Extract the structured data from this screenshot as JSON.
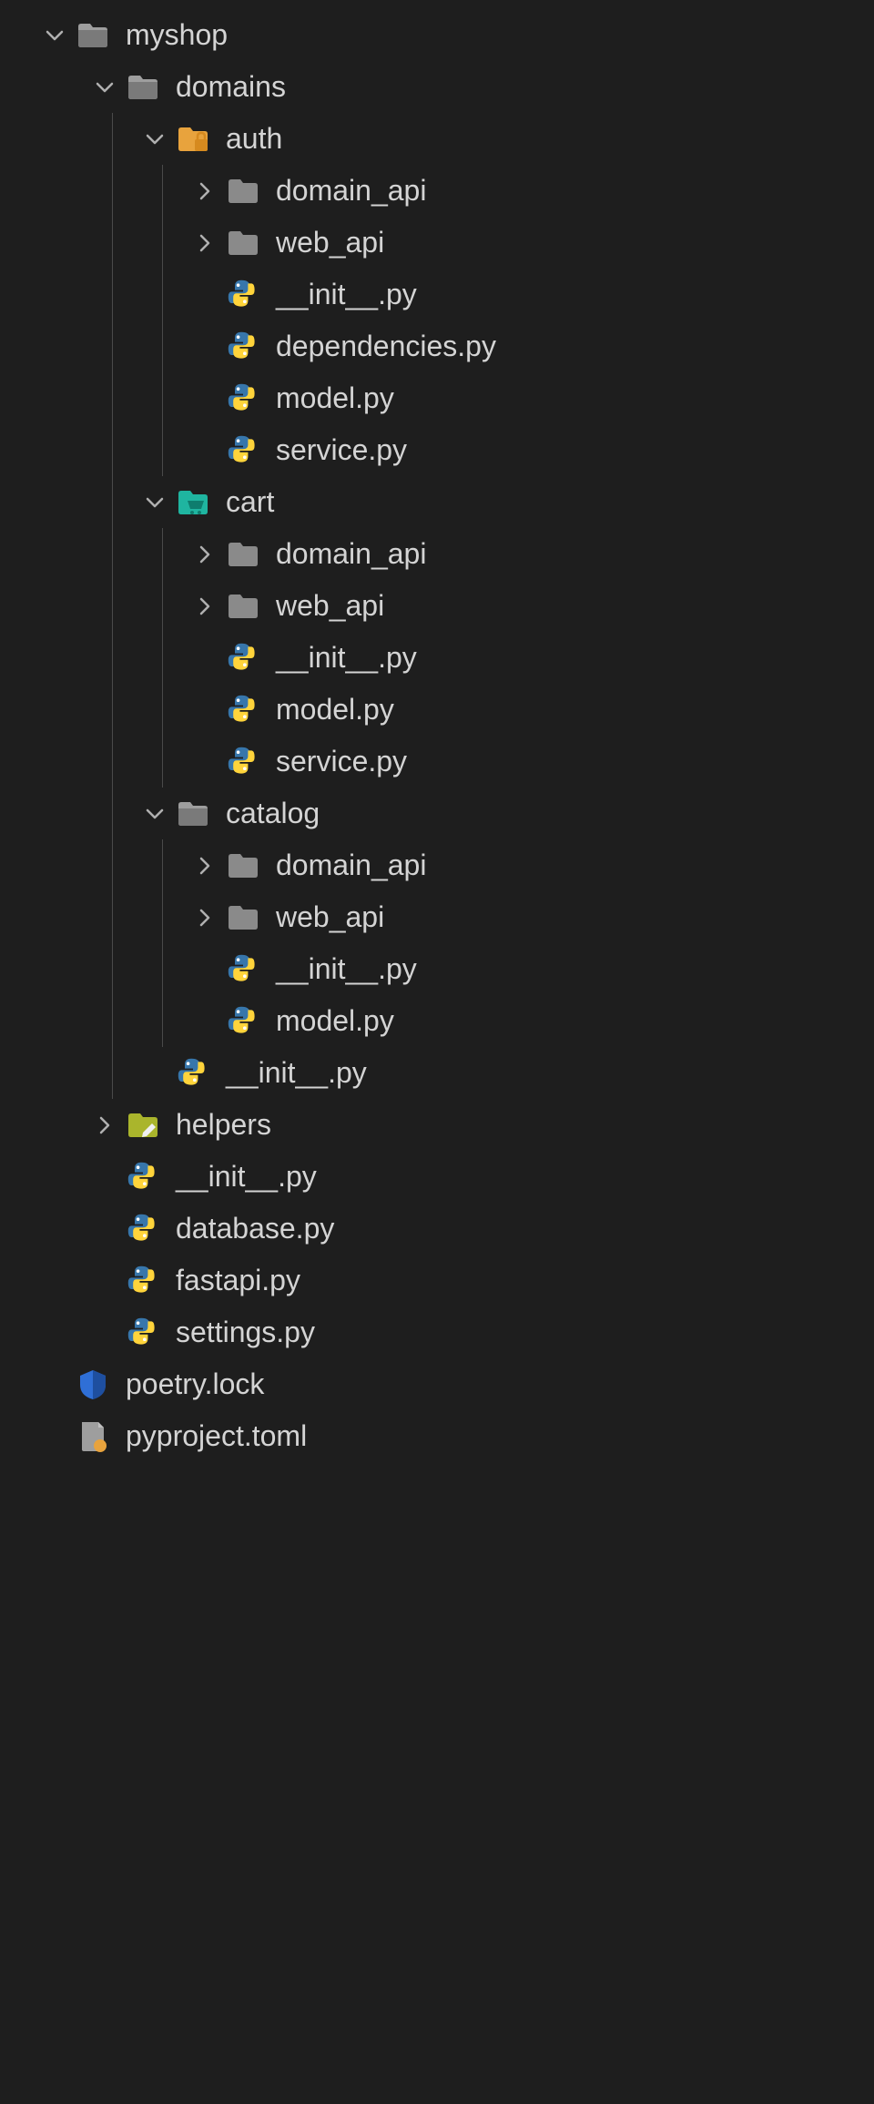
{
  "tree": [
    {
      "depth": 0,
      "chev": "down",
      "icon": "folder-open",
      "label": "myshop"
    },
    {
      "depth": 1,
      "chev": "down",
      "icon": "folder-open",
      "label": "domains"
    },
    {
      "depth": 2,
      "chev": "down",
      "icon": "folder-lock",
      "label": "auth"
    },
    {
      "depth": 3,
      "chev": "right",
      "icon": "folder",
      "label": "domain_api"
    },
    {
      "depth": 3,
      "chev": "right",
      "icon": "folder",
      "label": "web_api"
    },
    {
      "depth": 3,
      "chev": "none",
      "icon": "python",
      "label": "__init__.py"
    },
    {
      "depth": 3,
      "chev": "none",
      "icon": "python",
      "label": "dependencies.py"
    },
    {
      "depth": 3,
      "chev": "none",
      "icon": "python",
      "label": "model.py"
    },
    {
      "depth": 3,
      "chev": "none",
      "icon": "python",
      "label": "service.py"
    },
    {
      "depth": 2,
      "chev": "down",
      "icon": "folder-cart",
      "label": "cart"
    },
    {
      "depth": 3,
      "chev": "right",
      "icon": "folder",
      "label": "domain_api"
    },
    {
      "depth": 3,
      "chev": "right",
      "icon": "folder",
      "label": "web_api"
    },
    {
      "depth": 3,
      "chev": "none",
      "icon": "python",
      "label": "__init__.py"
    },
    {
      "depth": 3,
      "chev": "none",
      "icon": "python",
      "label": "model.py"
    },
    {
      "depth": 3,
      "chev": "none",
      "icon": "python",
      "label": "service.py"
    },
    {
      "depth": 2,
      "chev": "down",
      "icon": "folder-open",
      "label": "catalog"
    },
    {
      "depth": 3,
      "chev": "right",
      "icon": "folder",
      "label": "domain_api"
    },
    {
      "depth": 3,
      "chev": "right",
      "icon": "folder",
      "label": "web_api"
    },
    {
      "depth": 3,
      "chev": "none",
      "icon": "python",
      "label": "__init__.py"
    },
    {
      "depth": 3,
      "chev": "none",
      "icon": "python",
      "label": "model.py"
    },
    {
      "depth": 2,
      "chev": "none",
      "icon": "python",
      "label": "__init__.py"
    },
    {
      "depth": 1,
      "chev": "right",
      "icon": "folder-edit",
      "label": "helpers"
    },
    {
      "depth": 1,
      "chev": "none",
      "icon": "python",
      "label": "__init__.py"
    },
    {
      "depth": 1,
      "chev": "none",
      "icon": "python",
      "label": "database.py"
    },
    {
      "depth": 1,
      "chev": "none",
      "icon": "python",
      "label": "fastapi.py"
    },
    {
      "depth": 1,
      "chev": "none",
      "icon": "python",
      "label": "settings.py"
    },
    {
      "depth": 0,
      "chev": "none",
      "icon": "lock-file",
      "label": "poetry.lock"
    },
    {
      "depth": 0,
      "chev": "none",
      "icon": "toml-file",
      "label": "pyproject.toml"
    }
  ]
}
